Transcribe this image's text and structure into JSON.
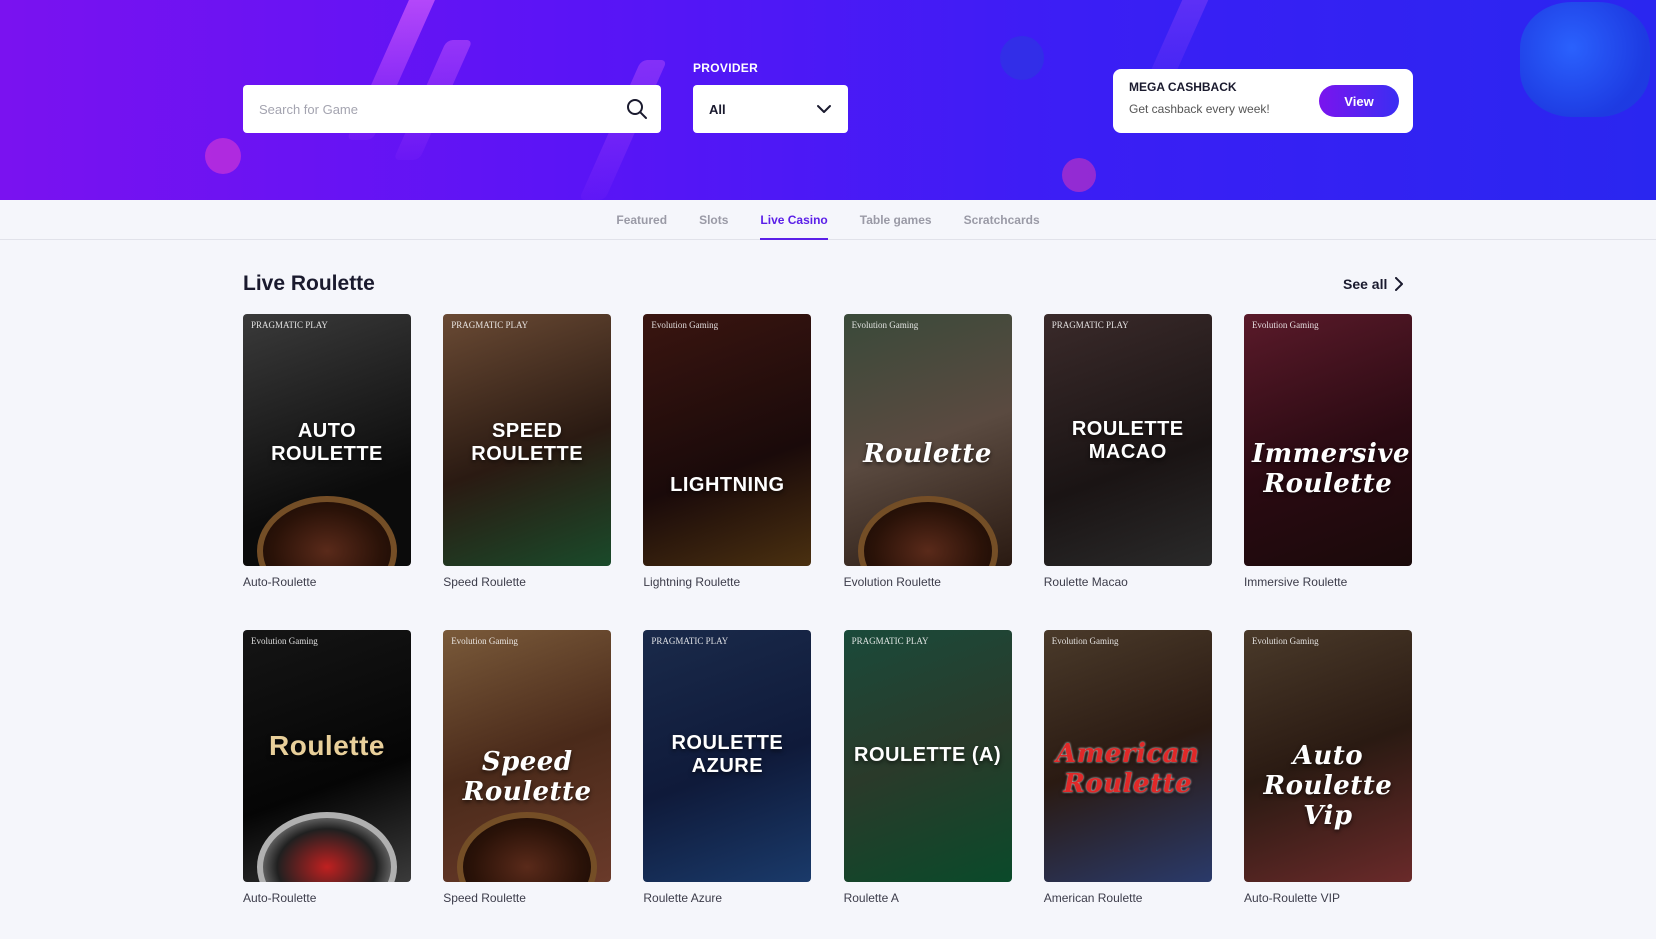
{
  "header": {
    "search": {
      "placeholder": "Search for Game",
      "icon": "search-icon"
    },
    "provider": {
      "label": "PROVIDER",
      "selected": "All",
      "icon": "chevron-down-icon"
    },
    "promo": {
      "title": "MEGA CASHBACK",
      "subtitle": "Get cashback every week!",
      "button_label": "View"
    }
  },
  "tabs": [
    {
      "label": "Featured",
      "active": false
    },
    {
      "label": "Slots",
      "active": false
    },
    {
      "label": "Live Casino",
      "active": true
    },
    {
      "label": "Table games",
      "active": false
    },
    {
      "label": "Scratchcards",
      "active": false
    }
  ],
  "section": {
    "title": "Live Roulette",
    "see_all_label": "See all",
    "games": [
      {
        "name": "Auto-Roulette",
        "provider_logo": "PRAGMATIC PLAY",
        "art_text": "AUTO ROULETTE"
      },
      {
        "name": "Speed Roulette",
        "provider_logo": "PRAGMATIC PLAY",
        "art_text": "SPEED ROULETTE"
      },
      {
        "name": "Lightning Roulette",
        "provider_logo": "Evolution Gaming",
        "art_text": "LIGHTNING"
      },
      {
        "name": "Evolution Roulette",
        "provider_logo": "Evolution Gaming",
        "art_text": "Roulette"
      },
      {
        "name": "Roulette Macao",
        "provider_logo": "PRAGMATIC PLAY",
        "art_text": "ROULETTE MACAO"
      },
      {
        "name": "Immersive Roulette",
        "provider_logo": "Evolution Gaming",
        "art_text": "Immersive Roulette"
      },
      {
        "name": "Auto-Roulette",
        "provider_logo": "Evolution Gaming",
        "art_text": "Roulette"
      },
      {
        "name": "Speed Roulette",
        "provider_logo": "Evolution Gaming",
        "art_text": "Speed Roulette"
      },
      {
        "name": "Roulette Azure",
        "provider_logo": "PRAGMATIC PLAY",
        "art_text": "ROULETTE AZURE"
      },
      {
        "name": "Roulette A",
        "provider_logo": "PRAGMATIC PLAY",
        "art_text": "ROULETTE (A)"
      },
      {
        "name": "American Roulette",
        "provider_logo": "Evolution Gaming",
        "art_text": "American Roulette"
      },
      {
        "name": "Auto-Roulette VIP",
        "provider_logo": "Evolution Gaming",
        "art_text": "Auto Roulette Vip"
      }
    ]
  }
}
